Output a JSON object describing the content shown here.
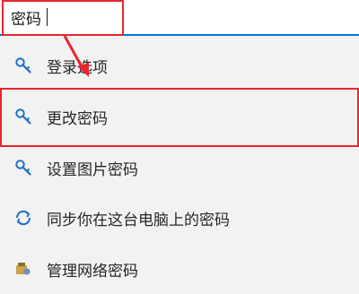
{
  "search": {
    "query": "密码"
  },
  "results": [
    {
      "label": "登录选项",
      "icon": "key-icon"
    },
    {
      "label": "更改密码",
      "icon": "key-icon"
    },
    {
      "label": "设置图片密码",
      "icon": "key-icon"
    },
    {
      "label": "同步你在这台电脑上的密码",
      "icon": "sync-icon"
    },
    {
      "label": "管理网络密码",
      "icon": "credential-manager-icon"
    }
  ],
  "colors": {
    "accent": "#0078d7",
    "highlight": "#e8262e",
    "icon": "#1e6fc9"
  }
}
